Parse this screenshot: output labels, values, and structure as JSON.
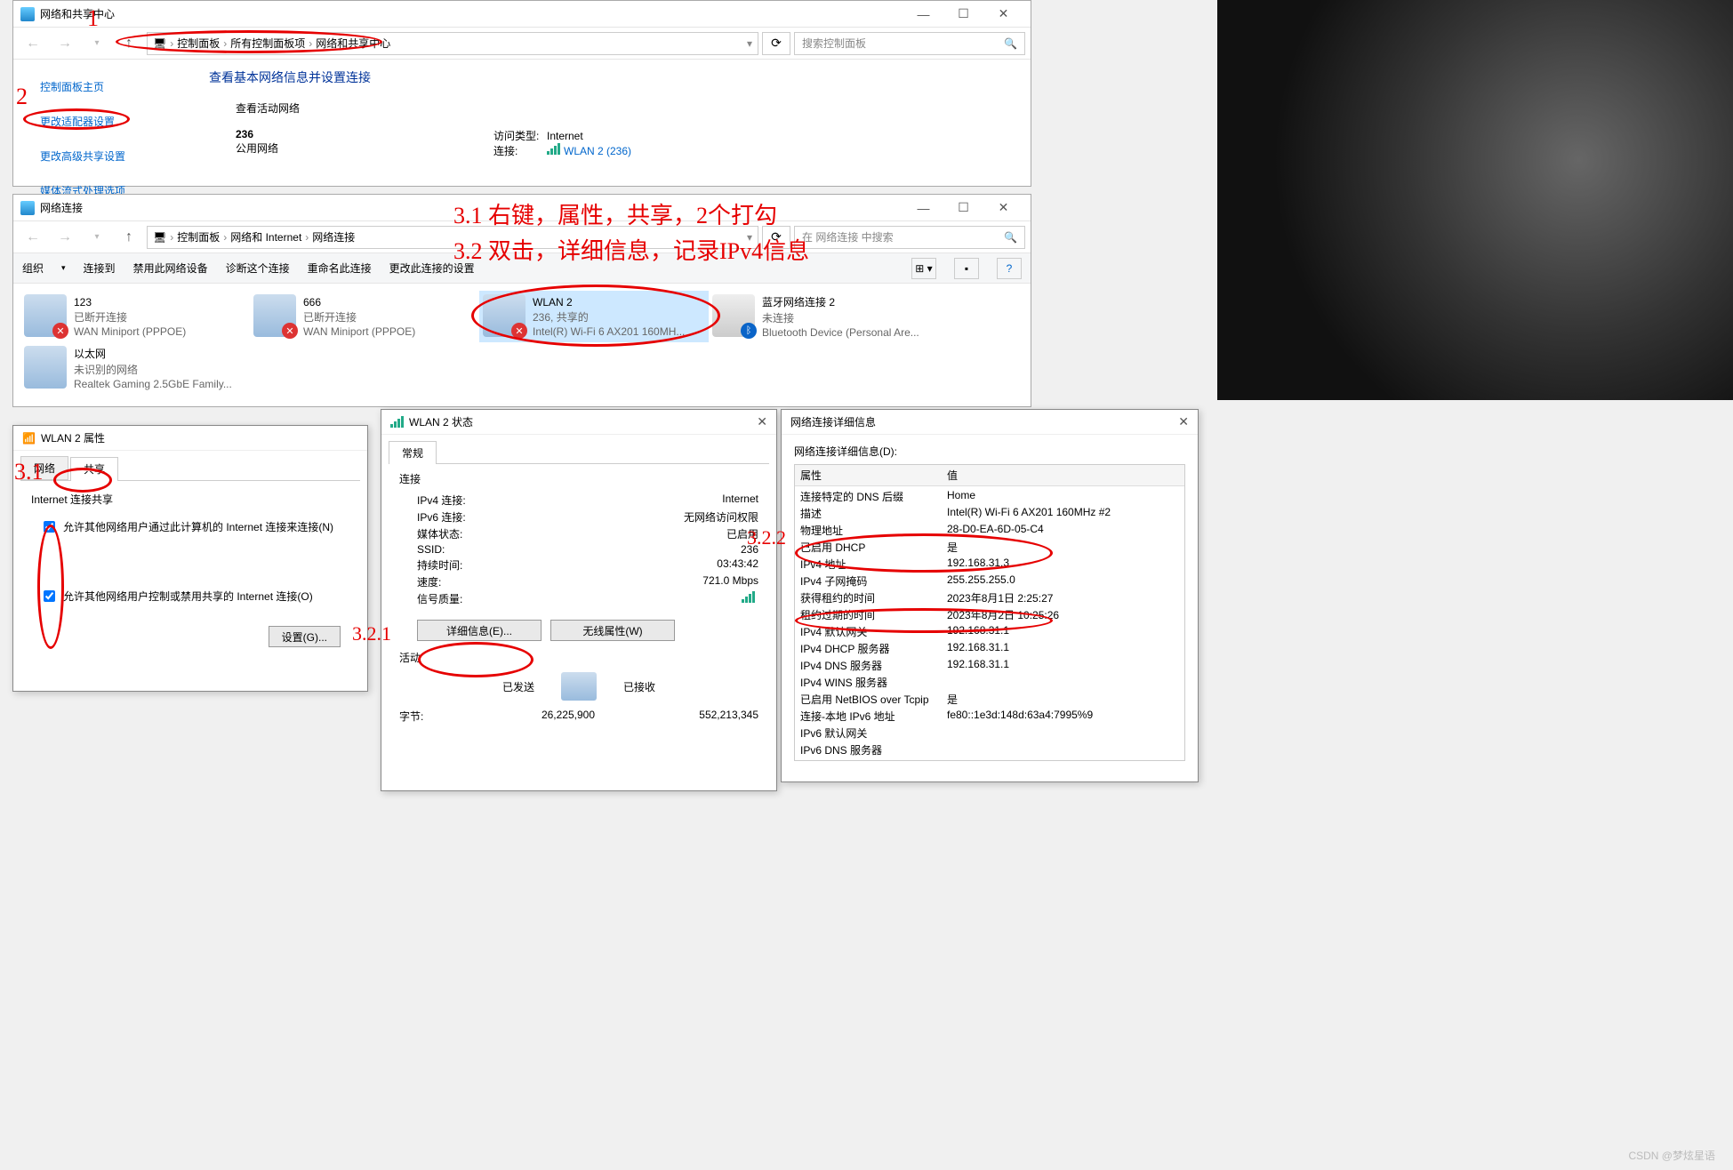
{
  "annotations": {
    "n1": "1",
    "n2": "2",
    "n31": "3.1",
    "n321": "3.2.1",
    "n322": "3.2.2",
    "line1": "3.1 右键，属性，共享，2个打勾",
    "line2": "3.2 双击，详细信息，记录IPv4信息"
  },
  "win1": {
    "title": "网络和共享中心",
    "crumbs": [
      "控制面板",
      "所有控制面板项",
      "网络和共享中心"
    ],
    "search_ph": "搜索控制面板",
    "side": {
      "home": "控制面板主页",
      "adapter": "更改适配器设置",
      "advshare": "更改高级共享设置",
      "media": "媒体流式处理选项"
    },
    "heading": "查看基本网络信息并设置连接",
    "sub": "查看活动网络",
    "net_name": "236",
    "net_type": "公用网络",
    "access_l": "访问类型:",
    "access_v": "Internet",
    "conn_l": "连接:",
    "conn_v": "WLAN 2 (236)"
  },
  "win2": {
    "title": "网络连接",
    "crumbs": [
      "控制面板",
      "网络和 Internet",
      "网络连接"
    ],
    "search_ph": "在 网络连接 中搜索",
    "cmds": {
      "org": "组织",
      "connto": "连接到",
      "disable": "禁用此网络设备",
      "diag": "诊断这个连接",
      "rename": "重命名此连接",
      "chg": "更改此连接的设置"
    },
    "items": [
      {
        "name": "123",
        "l2": "已断开连接",
        "l3": "WAN Miniport (PPPOE)",
        "sub": "x"
      },
      {
        "name": "666",
        "l2": "已断开连接",
        "l3": "WAN Miniport (PPPOE)",
        "sub": "x"
      },
      {
        "name": "WLAN 2",
        "l2": "236, 共享的",
        "l3": "Intel(R) Wi-Fi 6 AX201 160MH...",
        "sub": "x",
        "sel": true,
        "wifi": true
      },
      {
        "name": "蓝牙网络连接 2",
        "l2": "未连接",
        "l3": "Bluetooth Device (Personal Are...",
        "sub": "b",
        "bt": true
      },
      {
        "name": "以太网",
        "l2": "未识别的网络",
        "l3": "Realtek Gaming 2.5GbE Family..."
      }
    ]
  },
  "dlg_prop": {
    "title": "WLAN 2 属性",
    "tab_net": "网络",
    "tab_share": "共享",
    "group": "Internet 连接共享",
    "chk1": "允许其他网络用户通过此计算机的 Internet 连接来连接(N)",
    "chk2": "允许其他网络用户控制或禁用共享的 Internet 连接(O)",
    "btn_set": "设置(G)..."
  },
  "dlg_status": {
    "title": "WLAN 2 状态",
    "tab": "常规",
    "sect_conn": "连接",
    "rows": [
      [
        "IPv4 连接:",
        "Internet"
      ],
      [
        "IPv6 连接:",
        "无网络访问权限"
      ],
      [
        "媒体状态:",
        "已启用"
      ],
      [
        "SSID:",
        "236"
      ],
      [
        "持续时间:",
        "03:43:42"
      ],
      [
        "速度:",
        "721.0 Mbps"
      ],
      [
        "信号质量:",
        ""
      ]
    ],
    "btn_detail": "详细信息(E)...",
    "btn_wifi": "无线属性(W)",
    "sect_act": "活动",
    "sent": "已发送",
    "recv": "已接收",
    "bytes_l": "字节:",
    "bytes_sent": "26,225,900",
    "bytes_recv": "552,213,345"
  },
  "dlg_detail": {
    "title": "网络连接详细信息",
    "header": "网络连接详细信息(D):",
    "col_prop": "属性",
    "col_val": "值",
    "rows": [
      [
        "连接特定的 DNS 后缀",
        "Home"
      ],
      [
        "描述",
        "Intel(R) Wi-Fi 6 AX201 160MHz #2"
      ],
      [
        "物理地址",
        "28-D0-EA-6D-05-C4"
      ],
      [
        "已启用 DHCP",
        "是"
      ],
      [
        "IPv4 地址",
        "192.168.31.3"
      ],
      [
        "IPv4 子网掩码",
        "255.255.255.0"
      ],
      [
        "获得租约的时间",
        "2023年8月1日 2:25:27"
      ],
      [
        "租约过期的时间",
        "2023年8月2日 10:25:26"
      ],
      [
        "IPv4 默认网关",
        "192.168.31.1"
      ],
      [
        "IPv4 DHCP 服务器",
        "192.168.31.1"
      ],
      [
        "IPv4 DNS 服务器",
        "192.168.31.1"
      ],
      [
        "IPv4 WINS 服务器",
        ""
      ],
      [
        "已启用 NetBIOS over Tcpip",
        "是"
      ],
      [
        "连接-本地 IPv6 地址",
        "fe80::1e3d:148d:63a4:7995%9"
      ],
      [
        "IPv6 默认网关",
        ""
      ],
      [
        "IPv6 DNS 服务器",
        ""
      ]
    ]
  },
  "watermark": "CSDN @梦炫星语"
}
